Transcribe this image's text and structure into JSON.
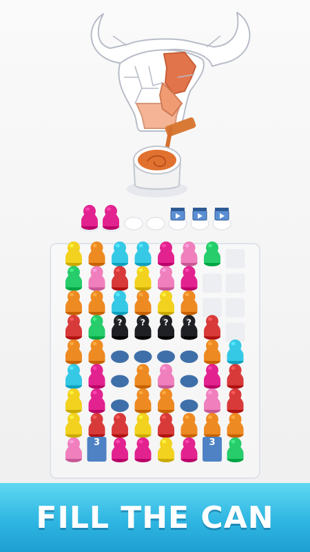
{
  "banner": {
    "text": "FILL THE CAN"
  },
  "colors": {
    "yellow": "#f2d21e",
    "orange": "#ee8a22",
    "cyan": "#35c9e6",
    "red": "#d83a3a",
    "pink": "#f07fbd",
    "magenta": "#e2238f",
    "green": "#27cc6b",
    "black": "#1f2024",
    "slotBlue": "#3f6fa8",
    "badgeBlue": "#4f82c4",
    "paint": "#e0712f",
    "gray": "#c9c9c9"
  },
  "queue": {
    "pawns": [
      "magenta",
      "magenta"
    ],
    "empty_slots": 2,
    "ad_slots": 3
  },
  "board": {
    "columns": [
      [
        "yellow",
        "green",
        "orange",
        "red",
        "orange",
        "cyan",
        "yellow",
        "yellow",
        "pink"
      ],
      [
        "orange",
        "pink",
        "orange",
        "green",
        "orange",
        "magenta",
        "magenta",
        "red",
        "badge"
      ],
      [
        "cyan",
        "red",
        "cyan",
        "hidden",
        "slot",
        "slot",
        "slot",
        "red",
        "magenta"
      ],
      [
        "cyan",
        "yellow",
        "orange",
        "hidden",
        "slot",
        "orange",
        "orange",
        "yellow",
        "magenta"
      ],
      [
        "magenta",
        "pink",
        "yellow",
        "hidden",
        "slot",
        "pink",
        "orange",
        "red",
        "yellow"
      ],
      [
        "pink",
        "magenta",
        "orange",
        "hidden",
        "slot",
        "slot",
        "slot",
        "orange",
        "magenta"
      ],
      [
        "green",
        "empty",
        "empty",
        "red",
        "orange",
        "magenta",
        "pink",
        "orange",
        "badge"
      ],
      [
        "empty",
        "empty",
        "empty",
        "empty",
        "cyan",
        "red",
        "red",
        "orange",
        "green"
      ]
    ],
    "hidden_mark": "?",
    "badge_count": "3"
  }
}
